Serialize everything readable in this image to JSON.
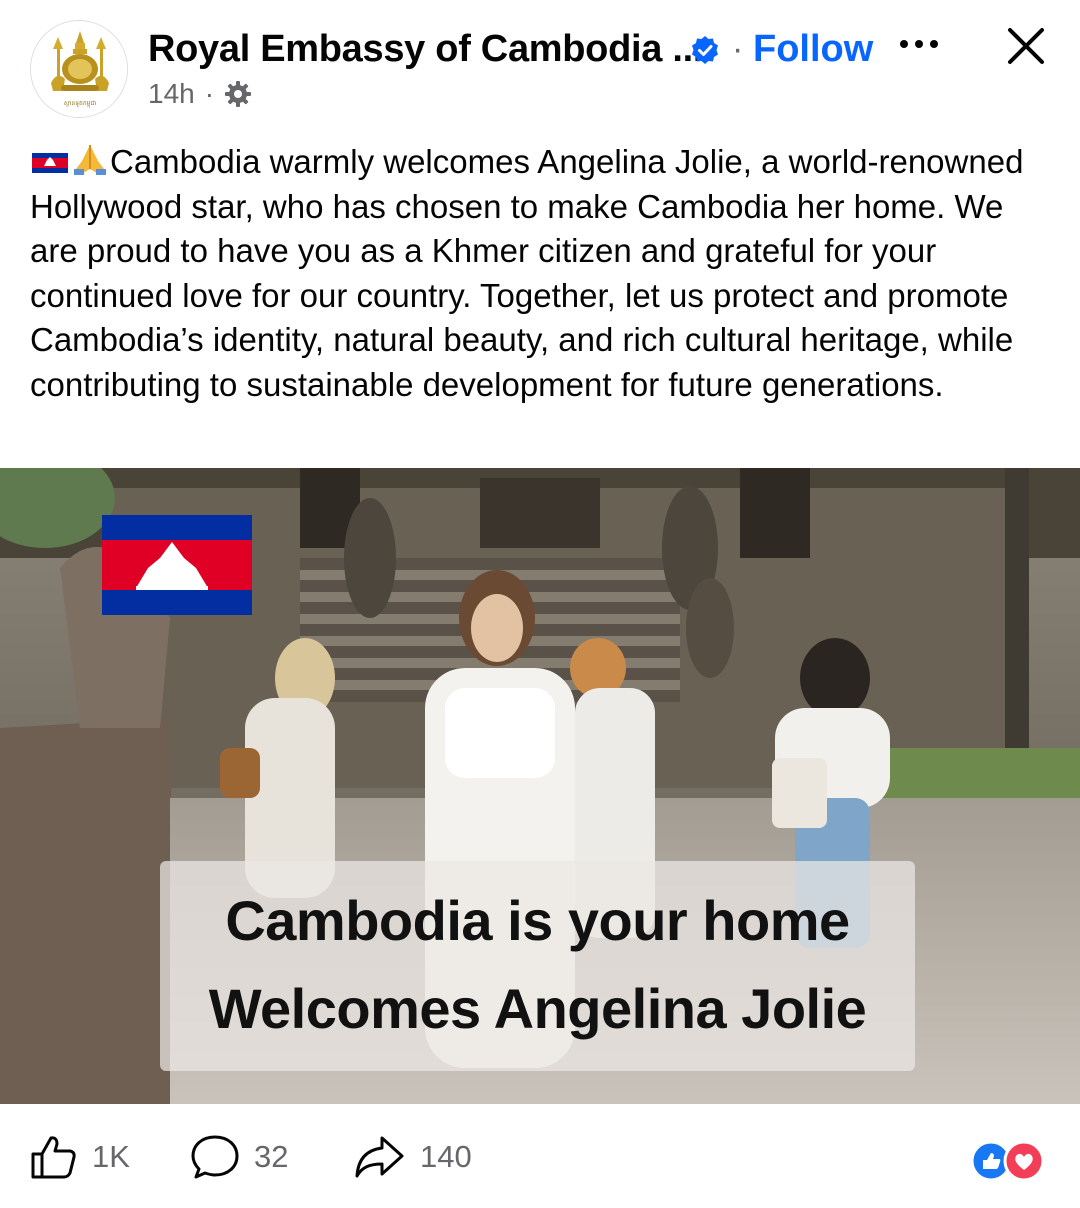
{
  "header": {
    "page_name": "Royal Embassy of Cambodia ...",
    "follow_label": "Follow",
    "separator": "·",
    "time": "14h",
    "meta_separator": "·",
    "avatar_caption": "ស្ថានទូតកម្ពុជា"
  },
  "post": {
    "text": "Cambodia warmly welcomes Angelina Jolie, a world-renowned Hollywood star, who has chosen to make Cambodia her home. We are proud to have you as a Khmer citizen and grateful for your continued love for our country. Together, let us protect and promote Cambodia’s identity, natural beauty, and rich cultural heritage, while contributing to sustainable development for future generations.",
    "image_caption_line1": "Cambodia is your home",
    "image_caption_line2": "Welcomes Angelina Jolie"
  },
  "footer": {
    "likes": "1K",
    "comments": "32",
    "shares": "140"
  },
  "colors": {
    "accent": "#0866ff",
    "secondary_text": "#65676b",
    "flag_blue": "#032ea1",
    "flag_red": "#e00025"
  },
  "icons": [
    "verified-badge-icon",
    "more-icon",
    "close-icon",
    "gear-icon",
    "cambodia-flag-icon",
    "folded-hands-icon",
    "like-icon",
    "comment-icon",
    "share-icon",
    "like-reaction-icon",
    "love-reaction-icon"
  ]
}
